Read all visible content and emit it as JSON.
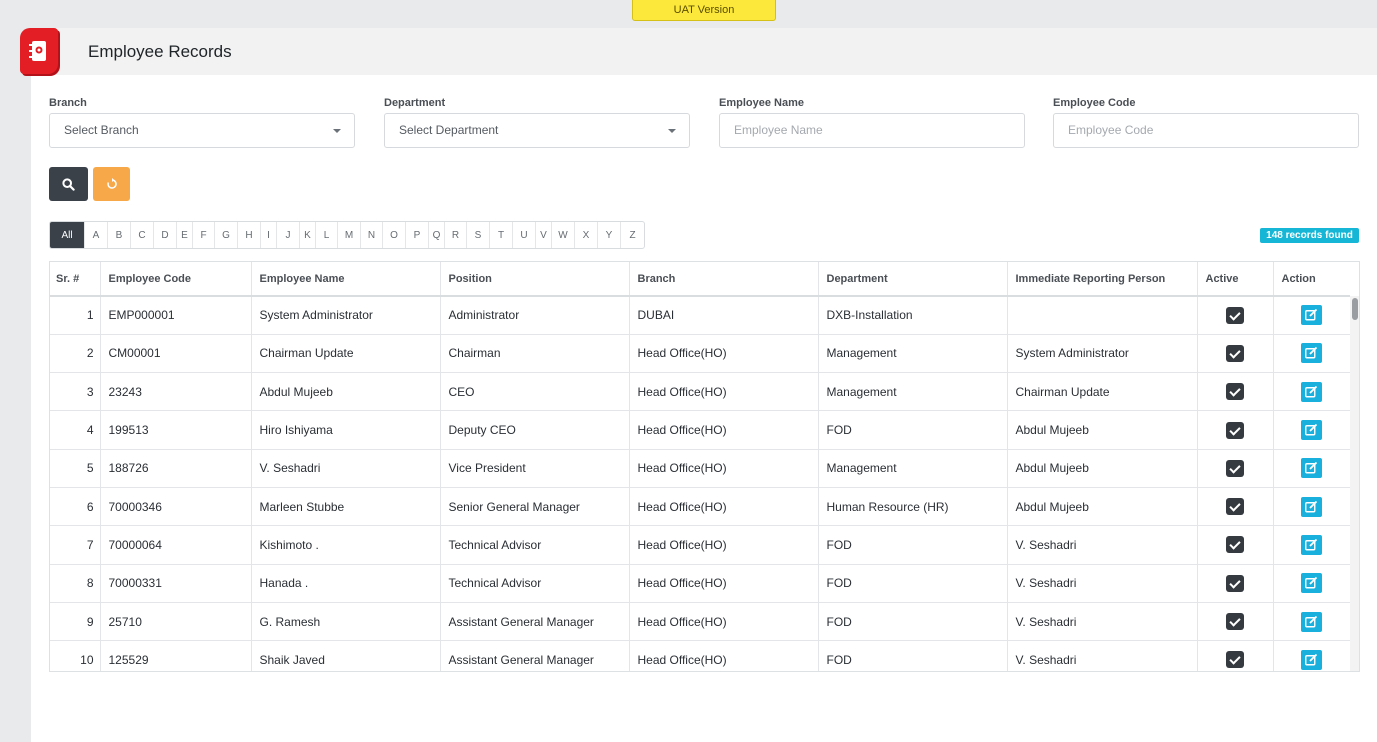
{
  "environment": {
    "badge": "UAT Version"
  },
  "header": {
    "title": "Employee Records"
  },
  "filters": {
    "branch": {
      "label": "Branch",
      "value": "Select Branch"
    },
    "department": {
      "label": "Department",
      "value": "Select Department"
    },
    "employee_name": {
      "label": "Employee Name",
      "placeholder": "Employee Name"
    },
    "employee_code": {
      "label": "Employee Code",
      "placeholder": "Employee Code"
    }
  },
  "alphabet": [
    "All",
    "A",
    "B",
    "C",
    "D",
    "E",
    "F",
    "G",
    "H",
    "I",
    "J",
    "K",
    "L",
    "M",
    "N",
    "O",
    "P",
    "Q",
    "R",
    "S",
    "T",
    "U",
    "V",
    "W",
    "X",
    "Y",
    "Z"
  ],
  "records_found": "148 records found",
  "table": {
    "columns": [
      "Sr. #",
      "Employee Code",
      "Employee Name",
      "Position",
      "Branch",
      "Department",
      "Immediate Reporting Person",
      "Active",
      "Action"
    ],
    "rows": [
      {
        "sr": "1",
        "code": "EMP000001",
        "name": "System Administrator",
        "position": "Administrator",
        "branch": "DUBAI",
        "department": "DXB-Installation",
        "reporting": ""
      },
      {
        "sr": "2",
        "code": "CM00001",
        "name": "Chairman Update",
        "position": "Chairman",
        "branch": "Head Office(HO)",
        "department": "Management",
        "reporting": "System Administrator"
      },
      {
        "sr": "3",
        "code": "23243",
        "name": "Abdul Mujeeb",
        "position": "CEO",
        "branch": "Head Office(HO)",
        "department": "Management",
        "reporting": "Chairman Update"
      },
      {
        "sr": "4",
        "code": "199513",
        "name": "Hiro Ishiyama",
        "position": "Deputy CEO",
        "branch": "Head Office(HO)",
        "department": "FOD",
        "reporting": "Abdul Mujeeb"
      },
      {
        "sr": "5",
        "code": "188726",
        "name": "V. Seshadri",
        "position": "Vice President",
        "branch": "Head Office(HO)",
        "department": "Management",
        "reporting": "Abdul Mujeeb"
      },
      {
        "sr": "6",
        "code": "70000346",
        "name": "Marleen Stubbe",
        "position": "Senior General Manager",
        "branch": "Head Office(HO)",
        "department": "Human Resource (HR)",
        "reporting": "Abdul Mujeeb"
      },
      {
        "sr": "7",
        "code": "70000064",
        "name": "Kishimoto .",
        "position": "Technical Advisor",
        "branch": "Head Office(HO)",
        "department": "FOD",
        "reporting": "V. Seshadri"
      },
      {
        "sr": "8",
        "code": "70000331",
        "name": "Hanada .",
        "position": "Technical Advisor",
        "branch": "Head Office(HO)",
        "department": "FOD",
        "reporting": "V. Seshadri"
      },
      {
        "sr": "9",
        "code": "25710",
        "name": "G. Ramesh",
        "position": "Assistant General Manager",
        "branch": "Head Office(HO)",
        "department": "FOD",
        "reporting": "V. Seshadri"
      },
      {
        "sr": "10",
        "code": "125529",
        "name": "Shaik Javed",
        "position": "Assistant General Manager",
        "branch": "Head Office(HO)",
        "department": "FOD",
        "reporting": "V. Seshadri"
      }
    ]
  },
  "icons": {
    "page": "employee-records-icon",
    "search": "search-icon",
    "reset": "reset-icon",
    "active": "checkbox-checked-icon",
    "edit": "edit-icon"
  },
  "colors": {
    "accent": "#16b7d6",
    "brand": "#e31e24",
    "dark_button": "#3a4149",
    "reset_button": "#f7a94a",
    "uat": "#fce83a"
  }
}
